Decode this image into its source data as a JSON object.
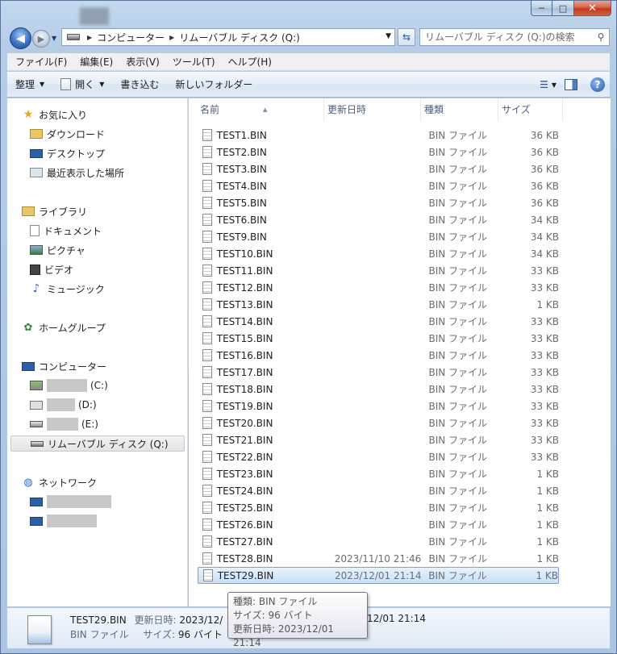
{
  "window": {
    "caption_buttons": {
      "minimize": "─",
      "maximize": "□",
      "close": "✕"
    }
  },
  "address": {
    "segments": [
      "コンピューター",
      "リムーバブル ディスク (Q:)"
    ],
    "back_glyph": "◀",
    "forward_glyph": "▶"
  },
  "search": {
    "placeholder": "リムーバブル ディスク (Q:)の検索"
  },
  "menu": [
    "ファイル(F)",
    "編集(E)",
    "表示(V)",
    "ツール(T)",
    "ヘルプ(H)"
  ],
  "toolbar": {
    "organize": "整理",
    "open": "開く",
    "burn": "書き込む",
    "new_folder": "新しいフォルダー"
  },
  "nav": {
    "favorites": "お気に入り",
    "downloads": "ダウンロード",
    "desktop": "デスクトップ",
    "recent": "最近表示した場所",
    "libraries": "ライブラリ",
    "documents": "ドキュメント",
    "pictures": "ピクチャ",
    "videos": "ビデオ",
    "music": "ミュージック",
    "homegroup": "ホームグループ",
    "computer": "コンピューター",
    "drive_c": "(C:)",
    "drive_d": "(D:)",
    "drive_e": "(E:)",
    "removable": "リムーバブル ディスク (Q:)",
    "network": "ネットワーク"
  },
  "columns": {
    "name": "名前",
    "date": "更新日時",
    "type": "種類",
    "size": "サイズ"
  },
  "files": [
    {
      "name": "TEST1.BIN",
      "date": "",
      "type": "BIN ファイル",
      "size": "36 KB"
    },
    {
      "name": "TEST2.BIN",
      "date": "",
      "type": "BIN ファイル",
      "size": "36 KB"
    },
    {
      "name": "TEST3.BIN",
      "date": "",
      "type": "BIN ファイル",
      "size": "36 KB"
    },
    {
      "name": "TEST4.BIN",
      "date": "",
      "type": "BIN ファイル",
      "size": "36 KB"
    },
    {
      "name": "TEST5.BIN",
      "date": "",
      "type": "BIN ファイル",
      "size": "36 KB"
    },
    {
      "name": "TEST6.BIN",
      "date": "",
      "type": "BIN ファイル",
      "size": "34 KB"
    },
    {
      "name": "TEST9.BIN",
      "date": "",
      "type": "BIN ファイル",
      "size": "34 KB"
    },
    {
      "name": "TEST10.BIN",
      "date": "",
      "type": "BIN ファイル",
      "size": "34 KB"
    },
    {
      "name": "TEST11.BIN",
      "date": "",
      "type": "BIN ファイル",
      "size": "33 KB"
    },
    {
      "name": "TEST12.BIN",
      "date": "",
      "type": "BIN ファイル",
      "size": "33 KB"
    },
    {
      "name": "TEST13.BIN",
      "date": "",
      "type": "BIN ファイル",
      "size": "1 KB"
    },
    {
      "name": "TEST14.BIN",
      "date": "",
      "type": "BIN ファイル",
      "size": "33 KB"
    },
    {
      "name": "TEST15.BIN",
      "date": "",
      "type": "BIN ファイル",
      "size": "33 KB"
    },
    {
      "name": "TEST16.BIN",
      "date": "",
      "type": "BIN ファイル",
      "size": "33 KB"
    },
    {
      "name": "TEST17.BIN",
      "date": "",
      "type": "BIN ファイル",
      "size": "33 KB"
    },
    {
      "name": "TEST18.BIN",
      "date": "",
      "type": "BIN ファイル",
      "size": "33 KB"
    },
    {
      "name": "TEST19.BIN",
      "date": "",
      "type": "BIN ファイル",
      "size": "33 KB"
    },
    {
      "name": "TEST20.BIN",
      "date": "",
      "type": "BIN ファイル",
      "size": "33 KB"
    },
    {
      "name": "TEST21.BIN",
      "date": "",
      "type": "BIN ファイル",
      "size": "33 KB"
    },
    {
      "name": "TEST22.BIN",
      "date": "",
      "type": "BIN ファイル",
      "size": "33 KB"
    },
    {
      "name": "TEST23.BIN",
      "date": "",
      "type": "BIN ファイル",
      "size": "1 KB"
    },
    {
      "name": "TEST24.BIN",
      "date": "",
      "type": "BIN ファイル",
      "size": "1 KB"
    },
    {
      "name": "TEST25.BIN",
      "date": "",
      "type": "BIN ファイル",
      "size": "1 KB"
    },
    {
      "name": "TEST26.BIN",
      "date": "",
      "type": "BIN ファイル",
      "size": "1 KB"
    },
    {
      "name": "TEST27.BIN",
      "date": "",
      "type": "BIN ファイル",
      "size": "1 KB"
    },
    {
      "name": "TEST28.BIN",
      "date": "2023/11/10 21:46",
      "type": "BIN ファイル",
      "size": "1 KB"
    },
    {
      "name": "TEST29.BIN",
      "date": "2023/12/01 21:14",
      "type": "BIN ファイル",
      "size": "1 KB"
    }
  ],
  "details": {
    "name": "TEST29.BIN",
    "modified_label": "更新日時:",
    "modified_value": "2023/12/01 21:14",
    "modified_value_visible": "2023/12/",
    "modified_tail": "12/01 21:14",
    "type": "BIN ファイル",
    "size_label": "サイズ:",
    "size_value": "96 バイト"
  },
  "tooltip": {
    "type": "種類: BIN ファイル",
    "size": "サイズ: 96 バイト",
    "modified": "更新日時: 2023/12/01 21:14"
  },
  "colors": {
    "selection": "#c9e0f8",
    "selection_border": "#7da2ce",
    "close_button": "#c2391d"
  }
}
